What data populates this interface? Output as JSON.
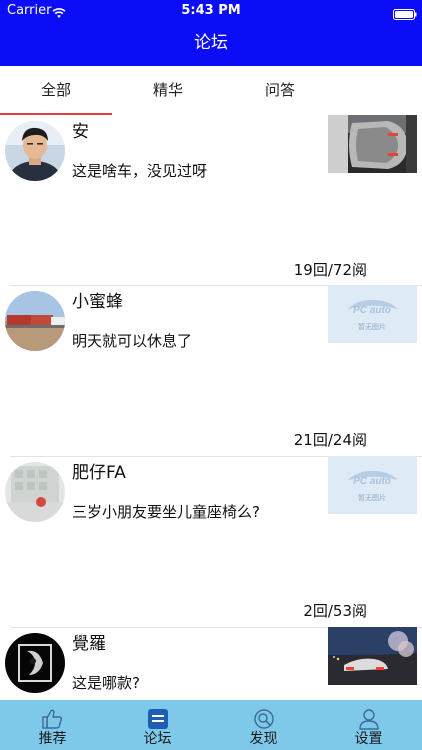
{
  "status_bar": {
    "carrier": "Carrier",
    "time": "5:43 PM",
    "wifi_icon": "wifi-icon",
    "battery_icon": "battery-full-icon"
  },
  "nav": {
    "title": "论坛",
    "background": "#0a0df5"
  },
  "tabs": {
    "items": [
      {
        "label": "全部",
        "selected": true
      },
      {
        "label": "精华",
        "selected": false
      },
      {
        "label": "问答",
        "selected": false
      }
    ],
    "indicator_color": "#e23b3b"
  },
  "posts": [
    {
      "username": "安",
      "content": "这是啥车，没见过呀",
      "stats": "19回/72阅",
      "thumbnail": "car-photo",
      "avatar": "user-avatar"
    },
    {
      "username": "小蜜蜂",
      "content": "明天就可以休息了",
      "stats": "21回/24阅",
      "thumbnail": "no-image-placeholder",
      "thumbnail_caption": "暂无图片",
      "avatar": "user-avatar"
    },
    {
      "username": "肥仔FA",
      "content": "三岁小朋友要坐儿童座椅么?",
      "stats": "2回/53阅",
      "thumbnail": "no-image-placeholder",
      "thumbnail_caption": "暂无图片",
      "avatar": "user-avatar"
    },
    {
      "username": "覺羅",
      "content": "这是哪款?",
      "stats": "",
      "thumbnail": "car-night-photo",
      "avatar": "user-avatar"
    }
  ],
  "tabbar": {
    "items": [
      {
        "label": "推荐",
        "icon": "thumbs-up-icon",
        "selected": false
      },
      {
        "label": "论坛",
        "icon": "forum-icon",
        "selected": true
      },
      {
        "label": "发现",
        "icon": "discover-icon",
        "selected": false
      },
      {
        "label": "设置",
        "icon": "person-icon",
        "selected": false
      }
    ],
    "background": "#7ec8ea",
    "selected_icon_color": "#1f5fb3"
  }
}
